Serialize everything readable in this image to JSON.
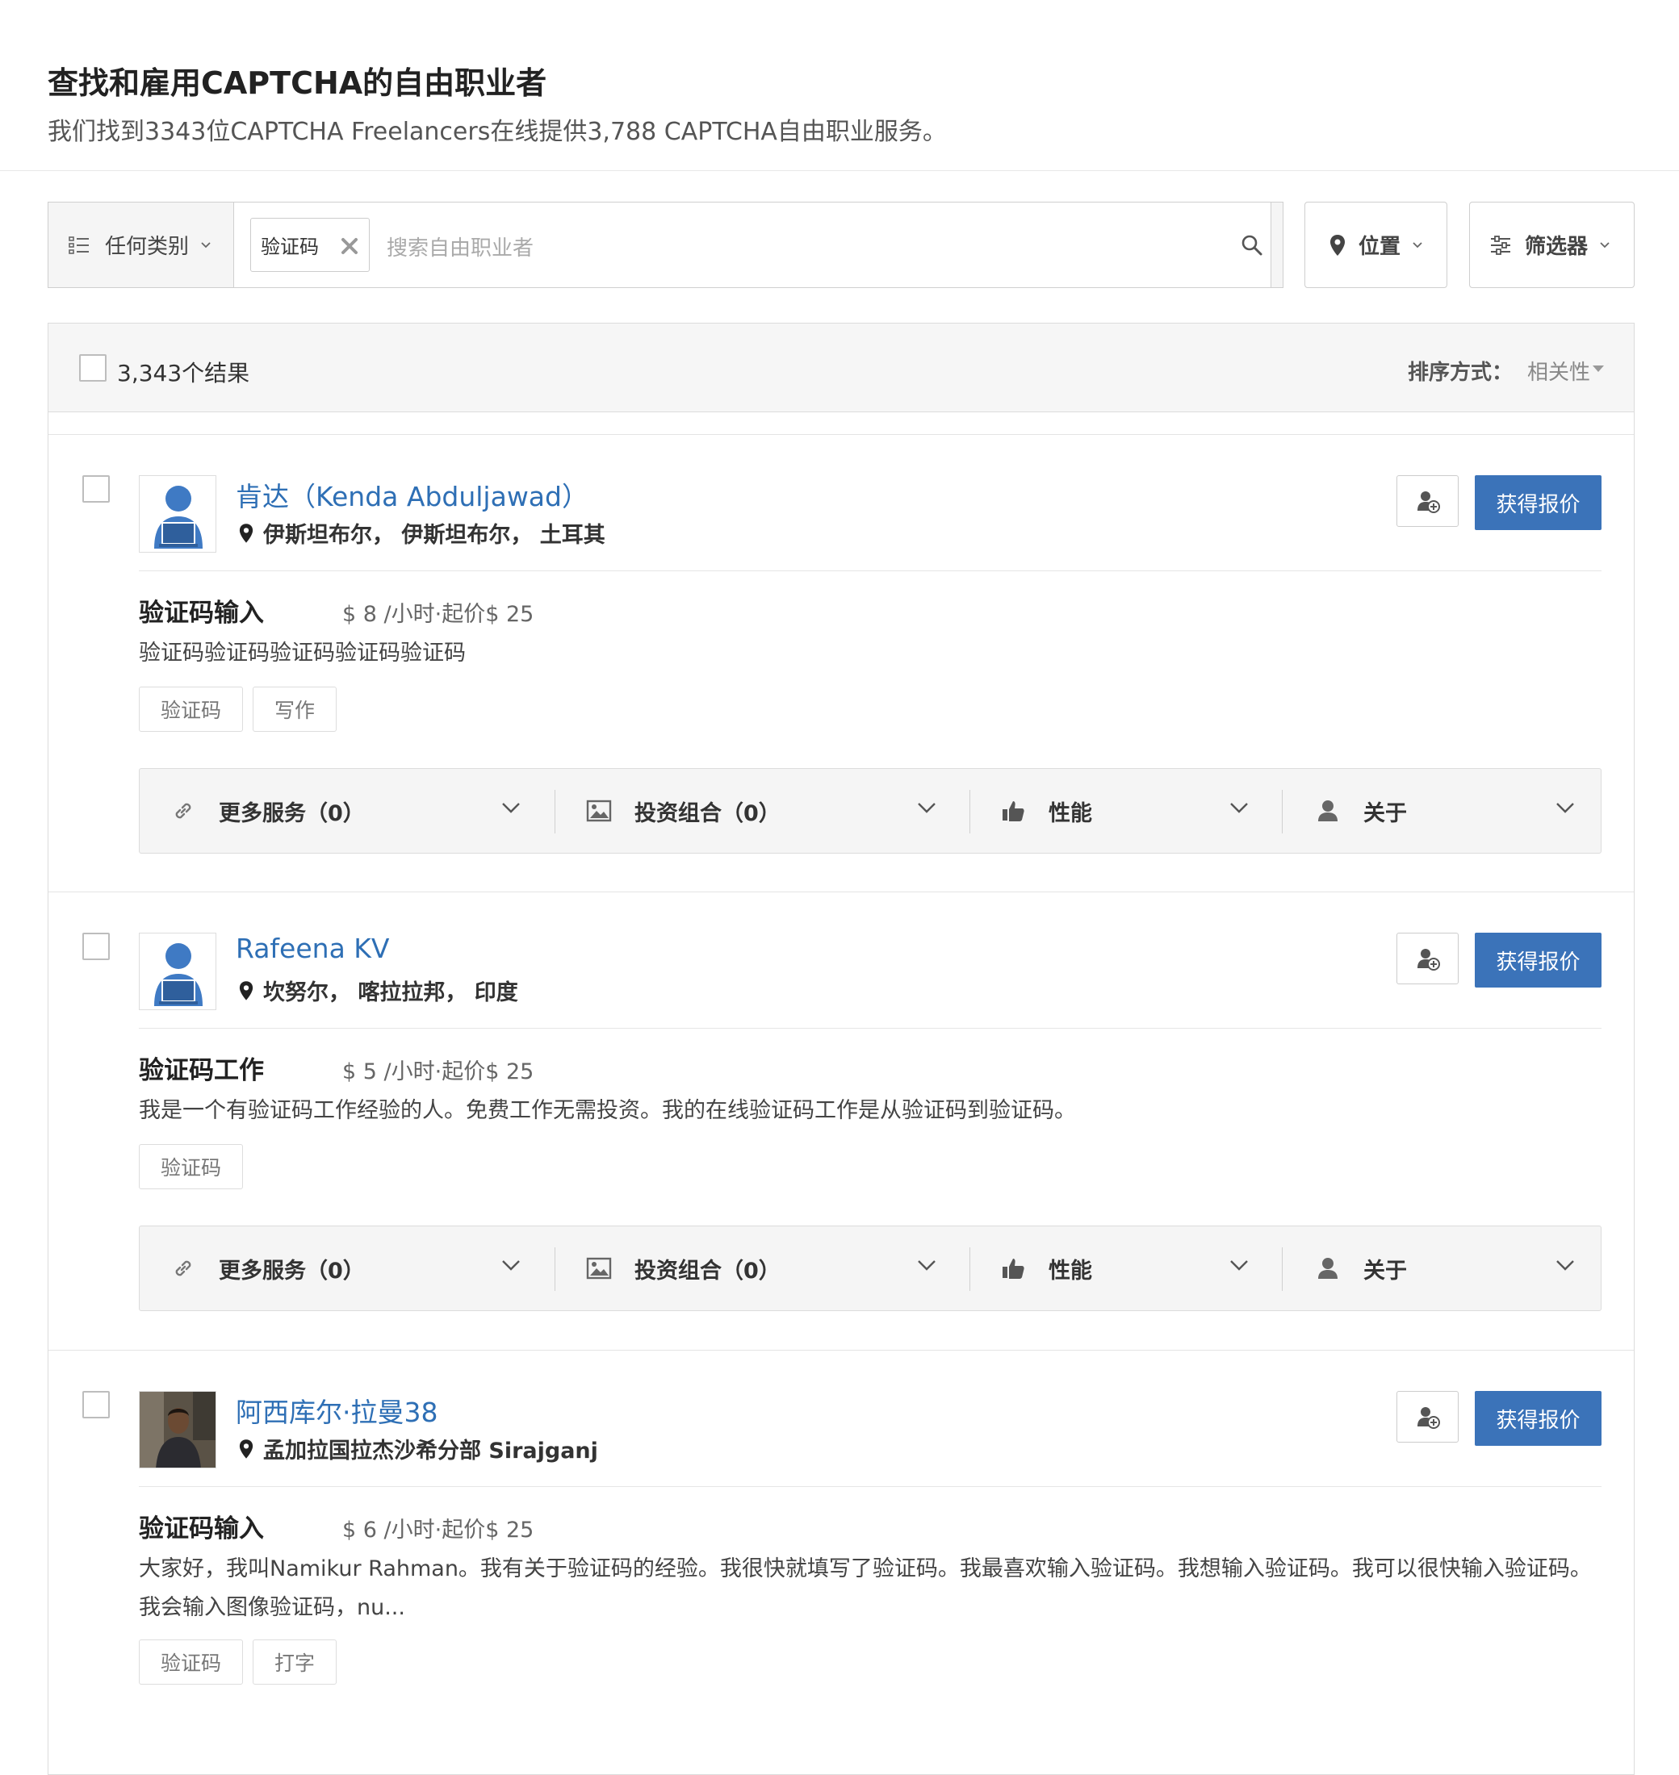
{
  "header": {
    "title": "查找和雇用CAPTCHA的自由职业者",
    "subtitle": "我们找到3343位CAPTCHA Freelancers在线提供3,788 CAPTCHA自由职业服务。"
  },
  "search": {
    "category_label": "任何类别",
    "active_tag": "验证码",
    "placeholder": "搜索自由职业者",
    "location_label": "位置",
    "filter_label": "筛选器"
  },
  "results": {
    "count_label": "3,343个结果",
    "sort_label": "排序方式：",
    "sort_value": "相关性"
  },
  "action_labels": {
    "more_services": "更多服务（0）",
    "portfolio": "投资组合（0）",
    "performance": "性能",
    "about": "关于"
  },
  "quote_label": "获得报价",
  "freelancers": [
    {
      "name": "肯达（Kenda Abduljawad）",
      "location": "伊斯坦布尔， 伊斯坦布尔， 土耳其",
      "avatar": "default-user-avatar",
      "service_title": "验证码输入",
      "service_price": "$ 8 /小时·起价$ 25",
      "description": "验证码验证码验证码验证码验证码",
      "tags": [
        "验证码",
        "写作"
      ]
    },
    {
      "name": "Rafeena KV",
      "location": "坎努尔， 喀拉拉邦， 印度",
      "avatar": "default-user-avatar",
      "service_title": "验证码工作",
      "service_price": "$ 5 /小时·起价$ 25",
      "description": "我是一个有验证码工作经验的人。免费工作无需投资。我的在线验证码工作是从验证码到验证码。",
      "tags": [
        "验证码"
      ]
    },
    {
      "name": "阿西库尔·拉曼38",
      "location": "孟加拉国拉杰沙希分部 Sirajganj",
      "avatar": "photo-avatar",
      "service_title": "验证码输入",
      "service_price": "$ 6 /小时·起价$ 25",
      "description": "大家好，我叫Namikur Rahman。我有关于验证码的经验。我很快就填写了验证码。我最喜欢输入验证码。我想输入验证码。我可以很快输入验证码。我会输入图像验证码，nu...",
      "tags": [
        "验证码",
        "打字"
      ]
    }
  ],
  "colors": {
    "link": "#2e6fb5",
    "primary_button": "#3b73b9"
  }
}
